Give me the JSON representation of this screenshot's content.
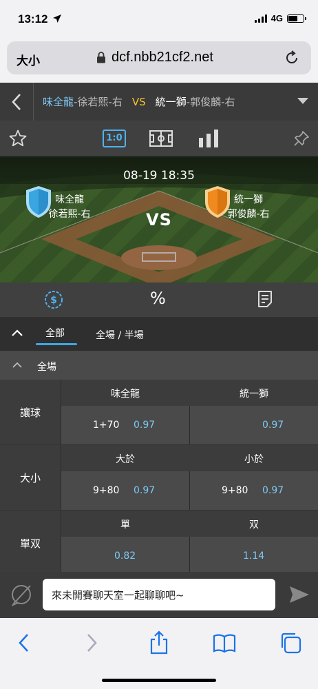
{
  "status_bar": {
    "time": "13:12",
    "network": "4G"
  },
  "browser": {
    "text_size_label": "大小",
    "url": "dcf.nbb21cf2.net"
  },
  "match_header": {
    "home_team": "味全龍",
    "home_pitcher": "-徐若熙-右",
    "vs": "VS",
    "away_team": "統一獅",
    "away_pitcher": "-郭俊麟-右"
  },
  "toolbar": {
    "score_label": "1:0"
  },
  "field": {
    "datetime": "08-19 18:35",
    "vs": "VS",
    "home": {
      "name": "味全龍",
      "pitcher": "徐若熙-右",
      "shield_color": "#3aa6e0"
    },
    "away": {
      "name": "統一獅",
      "pitcher": "郭俊麟-右",
      "shield_color": "#f08a1e"
    }
  },
  "icon_row": {
    "percent_label": "%"
  },
  "tabs": {
    "all": "全部",
    "full_half": "全場 / 半場"
  },
  "section": {
    "title": "全場"
  },
  "bets": [
    {
      "label": "讓球",
      "headers": [
        "味全龍",
        "統一獅"
      ],
      "cells": [
        {
          "line": "1+70",
          "odds": "0.97"
        },
        {
          "line": "",
          "odds": "0.97"
        }
      ]
    },
    {
      "label": "大小",
      "headers": [
        "大於",
        "小於"
      ],
      "cells": [
        {
          "line": "9+80",
          "odds": "0.97"
        },
        {
          "line": "9+80",
          "odds": "0.97"
        }
      ]
    },
    {
      "label": "單双",
      "headers": [
        "單",
        "双"
      ],
      "cells": [
        {
          "line": "",
          "odds": "0.82"
        },
        {
          "line": "",
          "odds": "1.14"
        }
      ]
    }
  ],
  "chat": {
    "placeholder": "來未開賽聊天室一起聊聊吧~"
  },
  "colors": {
    "accent_blue": "#7ec8f2",
    "vs_yellow": "#f6c22c",
    "tab_underline": "#3fa7e6",
    "ios_blue": "#1a73e8"
  }
}
